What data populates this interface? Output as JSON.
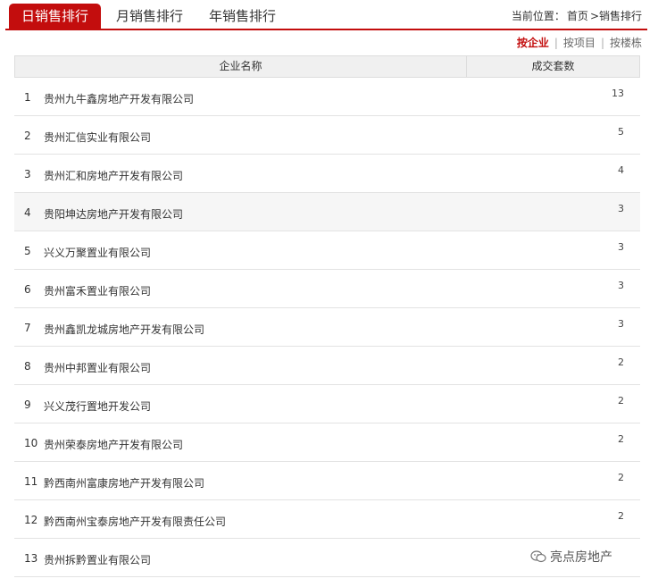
{
  "tabs": [
    {
      "label": "日销售排行",
      "active": true
    },
    {
      "label": "月销售排行",
      "active": false
    },
    {
      "label": "年销售排行",
      "active": false
    }
  ],
  "breadcrumb": {
    "prefix": "当前位置：",
    "home": "首页",
    "current": ">销售排行"
  },
  "filters": [
    {
      "label": "按企业",
      "active": true
    },
    {
      "label": "按项目",
      "active": false
    },
    {
      "label": "按楼栋",
      "active": false
    }
  ],
  "table": {
    "headers": {
      "name": "企业名称",
      "count": "成交套数"
    },
    "rows": [
      {
        "idx": "1",
        "name": "贵州九牛鑫房地产开发有限公司",
        "count": "13"
      },
      {
        "idx": "2",
        "name": "贵州汇信实业有限公司",
        "count": "5"
      },
      {
        "idx": "3",
        "name": "贵州汇和房地产开发有限公司",
        "count": "4"
      },
      {
        "idx": "4",
        "name": "贵阳坤达房地产开发有限公司",
        "count": "3"
      },
      {
        "idx": "5",
        "name": "兴义万聚置业有限公司",
        "count": "3"
      },
      {
        "idx": "6",
        "name": "贵州富禾置业有限公司",
        "count": "3"
      },
      {
        "idx": "7",
        "name": "贵州鑫凯龙城房地产开发有限公司",
        "count": "3"
      },
      {
        "idx": "8",
        "name": "贵州中邦置业有限公司",
        "count": "2"
      },
      {
        "idx": "9",
        "name": "兴义茂行置地开发公司",
        "count": "2"
      },
      {
        "idx": "10",
        "name": "贵州荣泰房地产开发有限公司",
        "count": "2"
      },
      {
        "idx": "11",
        "name": "黔西南州富康房地产开发有限公司",
        "count": "2"
      },
      {
        "idx": "12",
        "name": "黔西南州宝泰房地产开发有限责任公司",
        "count": "2"
      },
      {
        "idx": "13",
        "name": "贵州拆黔置业有限公司",
        "count": ""
      }
    ]
  },
  "watermark": {
    "text": "亮点房地产",
    "icon": "wechat-icon"
  }
}
